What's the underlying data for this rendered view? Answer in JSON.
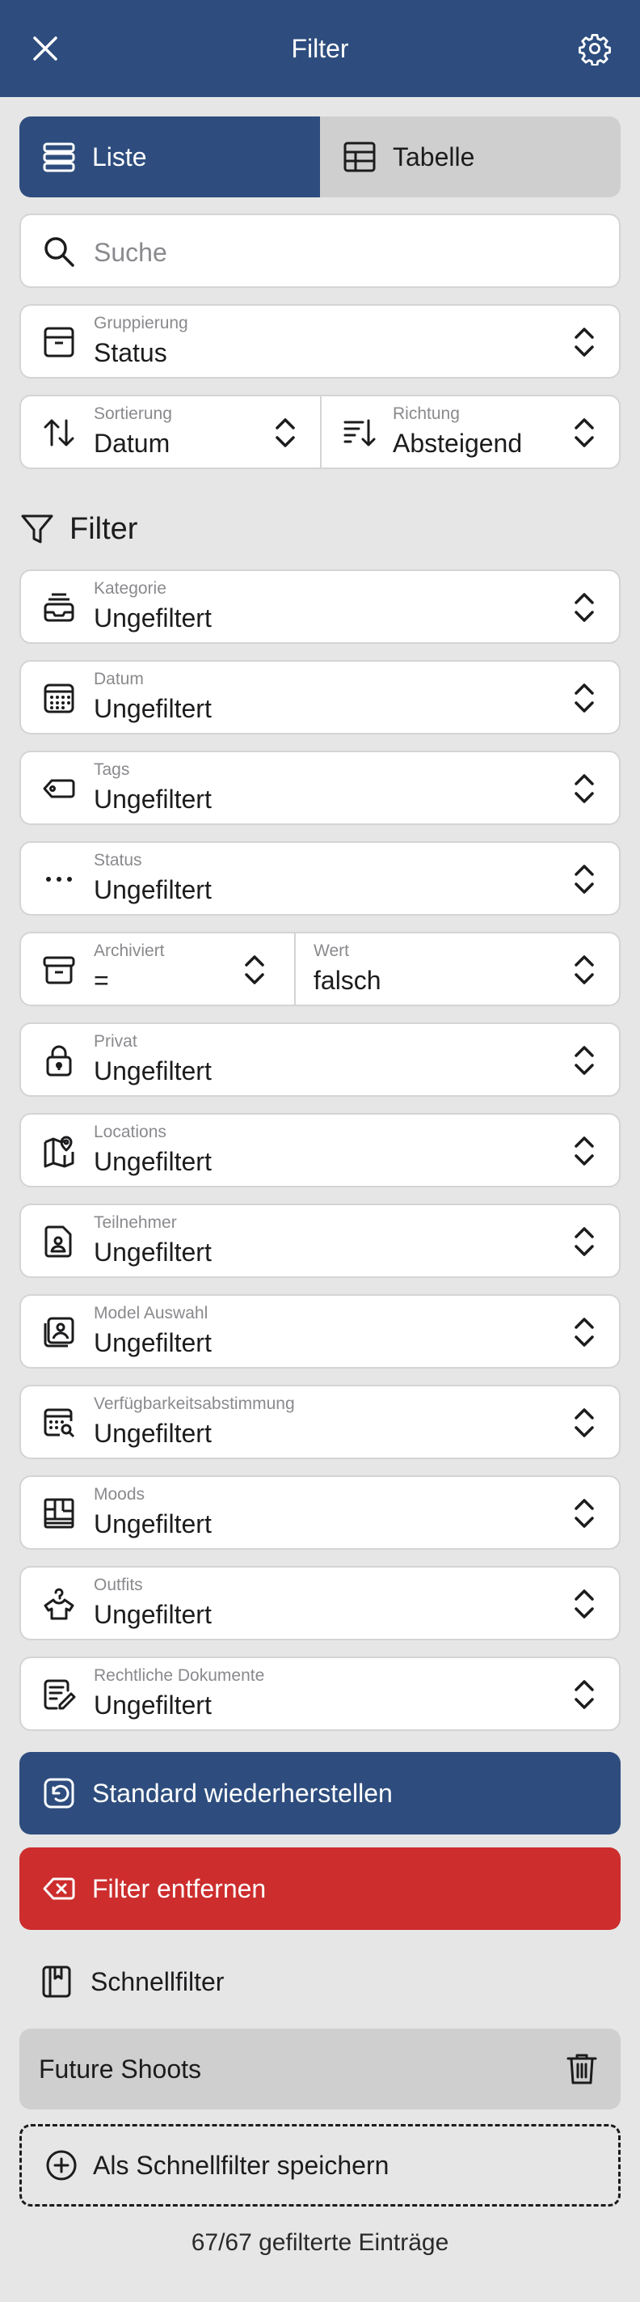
{
  "header": {
    "title": "Filter"
  },
  "view_toggle": {
    "list_label": "Liste",
    "table_label": "Tabelle",
    "selected": "Liste"
  },
  "search": {
    "placeholder": "Suche"
  },
  "grouping": {
    "label": "Gruppierung",
    "value": "Status"
  },
  "sorting": {
    "label": "Sortierung",
    "value": "Datum"
  },
  "direction": {
    "label": "Richtung",
    "value": "Absteigend"
  },
  "filter_section": {
    "title": "Filter"
  },
  "filters": [
    {
      "label": "Kategorie",
      "value": "Ungefiltert",
      "icon": "tray-stack-icon"
    },
    {
      "label": "Datum",
      "value": "Ungefiltert",
      "icon": "calendar-icon"
    },
    {
      "label": "Tags",
      "value": "Ungefiltert",
      "icon": "tag-icon"
    },
    {
      "label": "Status",
      "value": "Ungefiltert",
      "icon": "ellipsis-icon"
    }
  ],
  "archived": {
    "label": "Archiviert",
    "operator": "=",
    "value_label": "Wert",
    "value": "falsch"
  },
  "filters2": [
    {
      "label": "Privat",
      "value": "Ungefiltert",
      "icon": "lock-icon"
    },
    {
      "label": "Locations",
      "value": "Ungefiltert",
      "icon": "map-pin-icon"
    },
    {
      "label": "Teilnehmer",
      "value": "Ungefiltert",
      "icon": "person-document-icon"
    },
    {
      "label": "Model Auswahl",
      "value": "Ungefiltert",
      "icon": "photo-stack-icon"
    },
    {
      "label": "Verfügbarkeitsabstimmung",
      "value": "Ungefiltert",
      "icon": "calendar-search-icon"
    },
    {
      "label": "Moods",
      "value": "Ungefiltert",
      "icon": "moodboard-icon"
    },
    {
      "label": "Outfits",
      "value": "Ungefiltert",
      "icon": "hanger-shirt-icon"
    },
    {
      "label": "Rechtliche Dokumente",
      "value": "Ungefiltert",
      "icon": "document-pen-icon"
    }
  ],
  "buttons": {
    "restore": "Standard wiederherstellen",
    "remove": "Filter entfernen"
  },
  "quick_filters": {
    "title": "Schnellfilter",
    "items": [
      "Future Shoots"
    ],
    "save_label": "Als Schnellfilter speichern"
  },
  "footer": {
    "count_text": "67/67 gefilterte Einträge"
  },
  "colors": {
    "primary": "#2e4d7e",
    "danger": "#cd2d2d",
    "background": "#e6e6e6",
    "card": "#ffffff"
  }
}
